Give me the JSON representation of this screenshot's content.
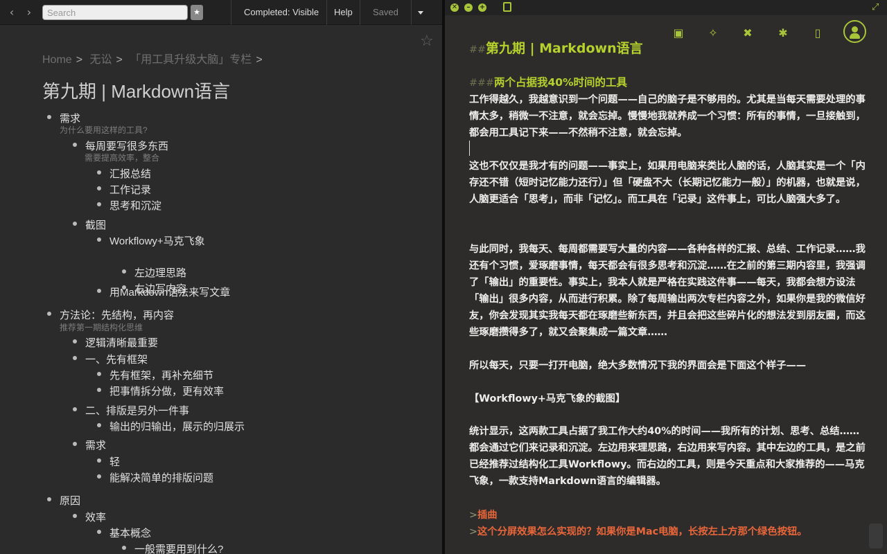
{
  "left": {
    "search_placeholder": "Search",
    "completed_label": "Completed: Visible",
    "help_label": "Help",
    "saved_label": "Saved",
    "breadcrumb": [
      "Home",
      "无讼",
      "「用工具升级大脑」专栏"
    ],
    "breadcrumb_sep": ">",
    "title": "第九期 | Markdown语言",
    "nodes": [
      {
        "text": "需求",
        "level": 0
      },
      {
        "text": "每周要写很多东西",
        "level": 1
      },
      {
        "text": "汇报总结",
        "level": 2
      },
      {
        "text": "工作记录",
        "level": 2
      },
      {
        "text": "思考和沉淀",
        "level": 2
      },
      {
        "text": "截图",
        "level": 1
      },
      {
        "text": "Workflowy+马克飞象",
        "level": 2
      },
      {
        "text": "左边理思路",
        "level": 3
      },
      {
        "text": "右边写内容",
        "level": 3
      },
      {
        "text": "用Markdown语法来写文章",
        "level": 2
      },
      {
        "text": "方法论：先结构，再内容",
        "level": 0
      },
      {
        "text": "逻辑清晰最重要",
        "level": 1
      },
      {
        "text": "一、先有框架",
        "level": 1
      },
      {
        "text": "先有框架，再补充细节",
        "level": 2
      },
      {
        "text": "把事情拆分做，更有效率",
        "level": 2
      },
      {
        "text": "二、排版是另外一件事",
        "level": 1
      },
      {
        "text": "输出的归输出，展示的归展示",
        "level": 2
      },
      {
        "text": "需求",
        "level": 1
      },
      {
        "text": "轻",
        "level": 2
      },
      {
        "text": "能解决简单的排版问题",
        "level": 2
      },
      {
        "text": "原因",
        "level": 0
      },
      {
        "text": "效率",
        "level": 1
      },
      {
        "text": "基本概念",
        "level": 2
      },
      {
        "text": "一般需要用到什么?",
        "level": 3
      }
    ],
    "notes": [
      {
        "text": "为什么要用这样的工具?"
      },
      {
        "text": "需要提高效率，整合"
      },
      {
        "text": "推荐第一期结构化思维"
      }
    ]
  },
  "editor": {
    "h2_hash": "##",
    "h2": "第九期 | Markdown语言",
    "h3_hash": "###",
    "h3": "两个占据我40%时间的工具",
    "p1": "工作得越久，我越意识到一个问题——自己的脑子是不够用的。尤其是当每天需要处理的事情太多，稍微一不注意，就会忘掉。慢慢地我就养成一个习惯：所有的事情，一旦接触到，都会用工具记下来——不然稍不注意，就会忘掉。",
    "p2": "这也不仅仅是我才有的问题——事实上，如果用电脑来类比人脑的话，人脑其实是一个「内存还不错（短时记忆能力还行）」但「硬盘不大（长期记忆能力一般）」的机器，也就是说，人脑更适合「思考」，而非「记忆」。而工具在「记录」这件事上，可比人脑强大多了。",
    "p3": "与此同时，我每天、每周都需要写大量的内容——各种各样的汇报、总结、工作记录……我还有个习惯，爱琢磨事情，每天都会有很多思考和沉淀……在之前的第三期内容里，我强调了「输出」的重要性。事实上，我本人就是严格在实践这件事——每天，我都会想方设法「输出」很多内容，从而进行积累。除了每周输出两次专栏内容之外，如果你是我的微信好友，你会发现其实我每天都在琢磨些新东西，并且会把这些碎片化的想法发到朋友圈，而这些琢磨攒得多了，就又会聚集成一篇文章……",
    "p4": "所以每天，只要一打开电脑，绝大多数情况下我的界面会是下面这个样子——",
    "p5": "【Workflowy+马克飞象的截图】",
    "p6": "统计显示，这两款工具占据了我工作大约40%的时间——我所有的计划、思考、总结……都会通过它们来记录和沉淀。左边用来理思路，右边用来写内容。其中左边的工具，是之前已经推荐过结构化工具Workflowy。而右边的工具，则是今天重点和大家推荐的——马克飞象，一款支持Markdown语言的编辑器。",
    "quote_mark": ">",
    "q1": "插曲",
    "q2": "这个分屏效果怎么实现的？如果你是Mac电脑，长按左上方那个绿色按钮。"
  }
}
